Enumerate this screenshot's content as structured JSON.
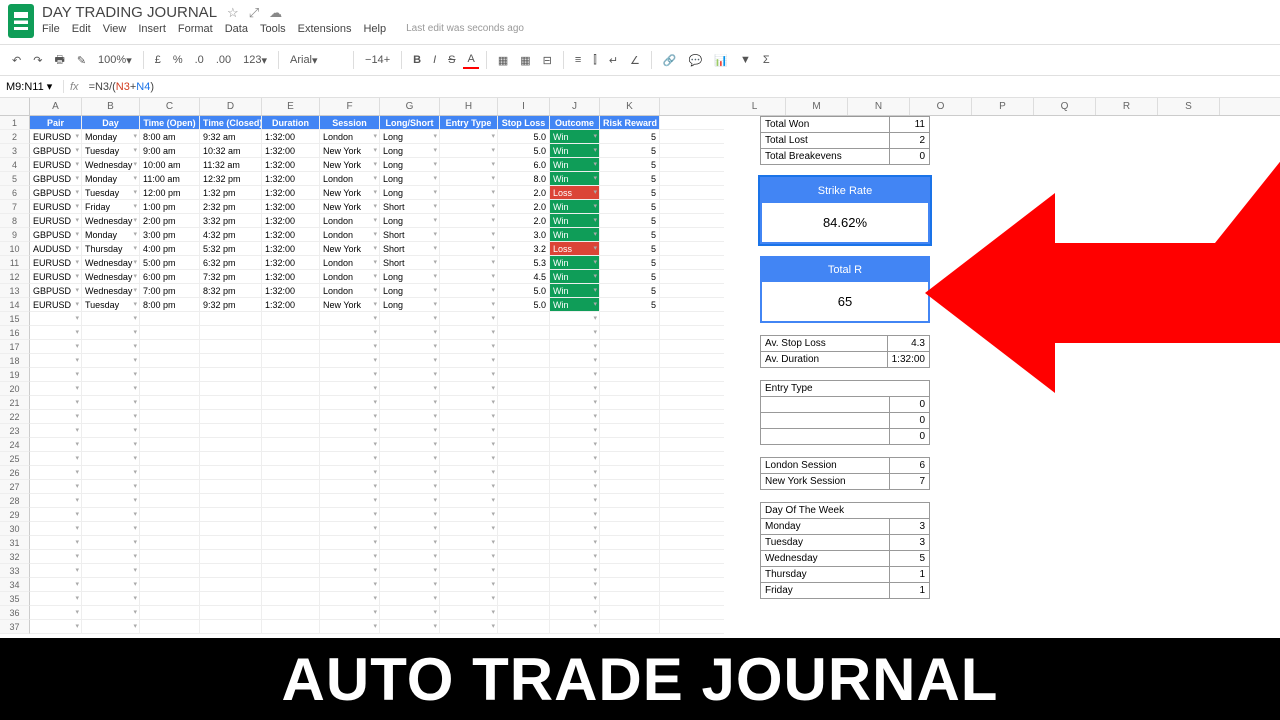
{
  "header": {
    "title": "DAY TRADING JOURNAL",
    "star_icon": "☆",
    "move_icon": "⤢",
    "cloud_icon": "☁",
    "menus": [
      "File",
      "Edit",
      "View",
      "Insert",
      "Format",
      "Data",
      "Tools",
      "Extensions",
      "Help"
    ],
    "last_edit": "Last edit was seconds ago"
  },
  "toolbar": {
    "undo": "↶",
    "redo": "↷",
    "print": "🖶",
    "paint": "✎",
    "zoom": "100%",
    "currency": "£",
    "percent": "%",
    "decimal_dec": ".0",
    "decimal_inc": ".00",
    "more_fmt": "123",
    "font": "Arial",
    "size": "14",
    "bold": "B",
    "italic": "I",
    "strike": "S",
    "textcolor": "A",
    "fill": "▦",
    "borders": "▦",
    "merge": "⊟",
    "halign": "≡",
    "valign": "⫿",
    "wrap": "↵",
    "rotate": "∠",
    "link": "🔗",
    "comment": "💬",
    "chart": "📊",
    "filter": "▼",
    "functions": "Σ"
  },
  "namebox": {
    "ref": "M9:N11",
    "fx": "fx",
    "formula_n3": "=N3",
    "formula_div": "/(",
    "formula_n3b": "N3",
    "formula_plus": "+",
    "formula_n4": "N4",
    "formula_close": ")"
  },
  "columns": {
    "letters": [
      "A",
      "B",
      "C",
      "D",
      "E",
      "F",
      "G",
      "H",
      "I",
      "J",
      "K"
    ],
    "letters_right": [
      "L",
      "M",
      "N",
      "O",
      "P",
      "Q",
      "R",
      "S"
    ],
    "widths": [
      52,
      58,
      60,
      62,
      58,
      60,
      60,
      58,
      52,
      50,
      60
    ],
    "headers": [
      "Pair",
      "Day",
      "Time (Open)",
      "Time (Closed)",
      "Duration",
      "Session",
      "Long/Short",
      "Entry Type",
      "Stop Loss",
      "Outcome",
      "Risk Reward"
    ]
  },
  "rows": [
    {
      "pair": "EURUSD",
      "day": "Monday",
      "open": "8:00 am",
      "close": "9:32 am",
      "dur": "1:32:00",
      "session": "London",
      "ls": "Long",
      "entry": "",
      "sl": "5.0",
      "outcome": "Win",
      "rr": "5"
    },
    {
      "pair": "GBPUSD",
      "day": "Tuesday",
      "open": "9:00 am",
      "close": "10:32 am",
      "dur": "1:32:00",
      "session": "New York",
      "ls": "Long",
      "entry": "",
      "sl": "5.0",
      "outcome": "Win",
      "rr": "5"
    },
    {
      "pair": "EURUSD",
      "day": "Wednesday",
      "open": "10:00 am",
      "close": "11:32 am",
      "dur": "1:32:00",
      "session": "New York",
      "ls": "Long",
      "entry": "",
      "sl": "6.0",
      "outcome": "Win",
      "rr": "5"
    },
    {
      "pair": "GBPUSD",
      "day": "Monday",
      "open": "11:00 am",
      "close": "12:32 pm",
      "dur": "1:32:00",
      "session": "London",
      "ls": "Long",
      "entry": "",
      "sl": "8.0",
      "outcome": "Win",
      "rr": "5"
    },
    {
      "pair": "GBPUSD",
      "day": "Tuesday",
      "open": "12:00 pm",
      "close": "1:32 pm",
      "dur": "1:32:00",
      "session": "New York",
      "ls": "Long",
      "entry": "",
      "sl": "2.0",
      "outcome": "Loss",
      "rr": "5"
    },
    {
      "pair": "EURUSD",
      "day": "Friday",
      "open": "1:00 pm",
      "close": "2:32 pm",
      "dur": "1:32:00",
      "session": "New York",
      "ls": "Short",
      "entry": "",
      "sl": "2.0",
      "outcome": "Win",
      "rr": "5"
    },
    {
      "pair": "EURUSD",
      "day": "Wednesday",
      "open": "2:00 pm",
      "close": "3:32 pm",
      "dur": "1:32:00",
      "session": "London",
      "ls": "Long",
      "entry": "",
      "sl": "2.0",
      "outcome": "Win",
      "rr": "5"
    },
    {
      "pair": "GBPUSD",
      "day": "Monday",
      "open": "3:00 pm",
      "close": "4:32 pm",
      "dur": "1:32:00",
      "session": "London",
      "ls": "Short",
      "entry": "",
      "sl": "3.0",
      "outcome": "Win",
      "rr": "5"
    },
    {
      "pair": "AUDUSD",
      "day": "Thursday",
      "open": "4:00 pm",
      "close": "5:32 pm",
      "dur": "1:32:00",
      "session": "New York",
      "ls": "Short",
      "entry": "",
      "sl": "3.2",
      "outcome": "Loss",
      "rr": "5"
    },
    {
      "pair": "EURUSD",
      "day": "Wednesday",
      "open": "5:00 pm",
      "close": "6:32 pm",
      "dur": "1:32:00",
      "session": "London",
      "ls": "Short",
      "entry": "",
      "sl": "5.3",
      "outcome": "Win",
      "rr": "5"
    },
    {
      "pair": "EURUSD",
      "day": "Wednesday",
      "open": "6:00 pm",
      "close": "7:32 pm",
      "dur": "1:32:00",
      "session": "London",
      "ls": "Long",
      "entry": "",
      "sl": "4.5",
      "outcome": "Win",
      "rr": "5"
    },
    {
      "pair": "GBPUSD",
      "day": "Wednesday",
      "open": "7:00 pm",
      "close": "8:32 pm",
      "dur": "1:32:00",
      "session": "London",
      "ls": "Long",
      "entry": "",
      "sl": "5.0",
      "outcome": "Win",
      "rr": "5"
    },
    {
      "pair": "EURUSD",
      "day": "Tuesday",
      "open": "8:00 pm",
      "close": "9:32 pm",
      "dur": "1:32:00",
      "session": "New York",
      "ls": "Long",
      "entry": "",
      "sl": "5.0",
      "outcome": "Win",
      "rr": "5"
    }
  ],
  "empty_rows": 23,
  "stats": {
    "totals": [
      {
        "label": "Total Won",
        "value": "11"
      },
      {
        "label": "Total Lost",
        "value": "2"
      },
      {
        "label": "Total Breakevens",
        "value": "0"
      }
    ],
    "strike_rate": {
      "label": "Strike Rate",
      "value": "84.62%"
    },
    "total_r": {
      "label": "Total R",
      "value": "65"
    },
    "averages": [
      {
        "label": "Av. Stop Loss",
        "value": "4.3"
      },
      {
        "label": "Av. Duration",
        "value": "1:32:00"
      }
    ],
    "entry_type": {
      "header": "Entry Type",
      "rows": [
        {
          "label": "",
          "value": "0"
        },
        {
          "label": "",
          "value": "0"
        },
        {
          "label": "",
          "value": "0"
        }
      ]
    },
    "sessions": [
      {
        "label": "London Session",
        "value": "6"
      },
      {
        "label": "New York Session",
        "value": "7"
      }
    ],
    "dow": {
      "header": "Day Of The Week",
      "rows": [
        {
          "label": "Monday",
          "value": "3"
        },
        {
          "label": "Tuesday",
          "value": "3"
        },
        {
          "label": "Wednesday",
          "value": "5"
        },
        {
          "label": "Thursday",
          "value": "1"
        },
        {
          "label": "Friday",
          "value": "1"
        }
      ]
    }
  },
  "banner": "AUTO TRADE JOURNAL"
}
